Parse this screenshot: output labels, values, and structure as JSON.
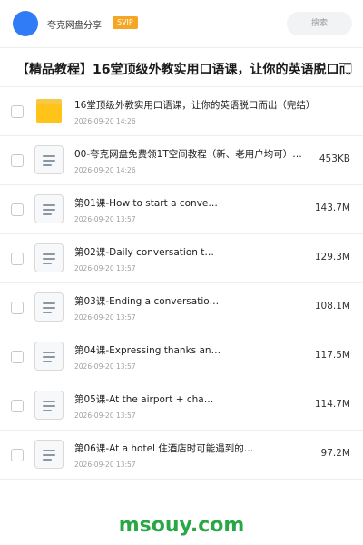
{
  "header": {
    "share_name": "夸克网盘分享",
    "badge": "SVIP",
    "search_label": "搜索",
    "avatar_color": "#2f7cf6",
    "badge_color": "#f5a623"
  },
  "folder": {
    "title": "【精品教程】16堂顶级外教实用口语课，让你的英语脱口而"
  },
  "files": [
    {
      "icon": "folder-icon",
      "name": "16堂顶级外教实用口语课，让你的英语脱口而出（完结）",
      "date": "2026-09-20 14:26",
      "size": ""
    },
    {
      "icon": "document-icon",
      "name": "00-夸克网盘免费领1T空间教程（新、老用户均可）…",
      "date": "2026-09-20 14:26",
      "size": "453KB"
    },
    {
      "icon": "document-icon",
      "name": "第01课-How to start a conve…",
      "date": "2026-09-20 13:57",
      "size": "143.7M"
    },
    {
      "icon": "document-icon",
      "name": "第02课-Daily conversation t…",
      "date": "2026-09-20 13:57",
      "size": "129.3M"
    },
    {
      "icon": "document-icon",
      "name": "第03课-Ending a conversatio…",
      "date": "2026-09-20 13:57",
      "size": "108.1M"
    },
    {
      "icon": "document-icon",
      "name": "第04课-Expressing thanks an…",
      "date": "2026-09-20 13:57",
      "size": "117.5M"
    },
    {
      "icon": "document-icon",
      "name": "第05课-At the airport + cha…",
      "date": "2026-09-20 13:57",
      "size": "114.7M"
    },
    {
      "icon": "document-icon",
      "name": "第06课-At a hotel 住酒店时可能遇到的…",
      "date": "2026-09-20 13:57",
      "size": "97.2M"
    }
  ],
  "watermark": {
    "text": "msouy.com",
    "color": "#28a745"
  }
}
